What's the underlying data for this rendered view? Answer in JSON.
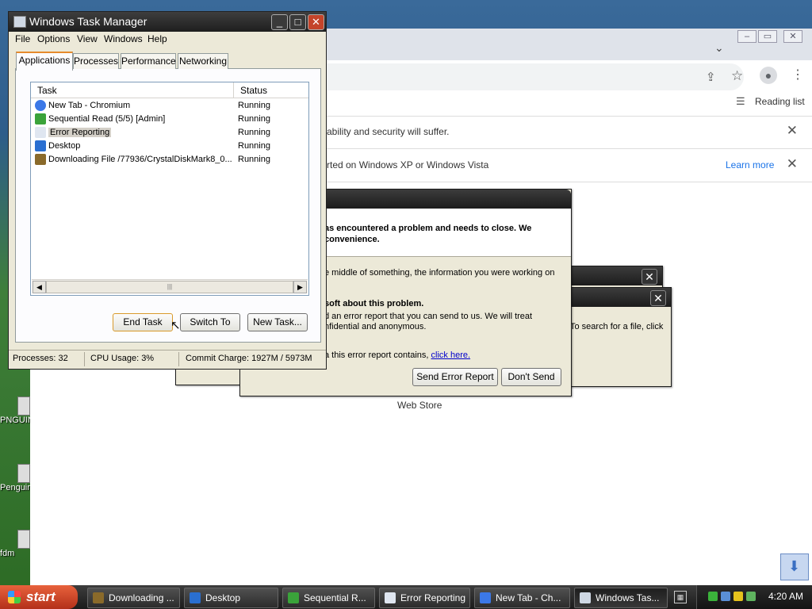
{
  "desktop": {
    "icons": [
      {
        "label": "PNGUIN"
      },
      {
        "label": "Penguin"
      },
      {
        "label": "fdm"
      }
    ]
  },
  "chrome": {
    "reading_list_label": "Reading list",
    "infobar1_text": "ability and security will suffer.",
    "infobar2_text": "rted on Windows XP or Windows Vista",
    "learn_more": "Learn more",
    "web_store_label": "Web Store"
  },
  "error_dialog": {
    "heading": "as encountered a problem and needs to close.  We",
    "heading2": "convenience.",
    "para1": "e middle of something, the information you were working on",
    "para2_title": "soft about this problem.",
    "para2_l1": "d an error report that you can send to us.  We will treat",
    "para2_l2": "nfidential and anonymous.",
    "para3": "a this error report contains,",
    "link": "click here.",
    "send_label": "Send Error Report",
    "dont_send_label": "Don't Send"
  },
  "search_dialog": {
    "text": "To search for a file, click"
  },
  "task_manager": {
    "title": "Windows Task Manager",
    "menu": [
      "File",
      "Options",
      "View",
      "Windows",
      "Help"
    ],
    "tabs": [
      "Applications",
      "Processes",
      "Performance",
      "Networking"
    ],
    "columns": {
      "task": "Task",
      "status": "Status"
    },
    "rows": [
      {
        "name": "New Tab - Chromium",
        "status": "Running",
        "icon": "chromium-icon",
        "color": "#3b78e7"
      },
      {
        "name": "Sequential Read (5/5) [Admin]",
        "status": "Running",
        "icon": "crystaldiskmark-icon",
        "color": "#3aa33a"
      },
      {
        "name": "Error Reporting",
        "status": "Running",
        "icon": "window-icon",
        "color": "#dfe6f0"
      },
      {
        "name": "Desktop",
        "status": "Running",
        "icon": "ie-icon",
        "color": "#2a6fd1"
      },
      {
        "name": "Downloading File /77936/CrystalDiskMark8_0...",
        "status": "Running",
        "icon": "fdm-icon",
        "color": "#8a6a2a"
      }
    ],
    "buttons": {
      "end_task": "End Task",
      "switch_to": "Switch To",
      "new_task": "New Task..."
    },
    "status": {
      "processes": "Processes: 32",
      "cpu": "CPU Usage: 3%",
      "commit": "Commit Charge: 1927M / 5973M"
    }
  },
  "taskbar": {
    "start_label": "start",
    "buttons": [
      {
        "label": "Downloading ...",
        "icon": "fdm-icon",
        "color": "#8a6a2a"
      },
      {
        "label": "Desktop",
        "icon": "ie-icon",
        "color": "#2a6fd1"
      },
      {
        "label": "Sequential R...",
        "icon": "crystaldiskmark-icon",
        "color": "#3aa33a"
      },
      {
        "label": "Error Reporting",
        "icon": "window-icon",
        "color": "#dfe6f0"
      },
      {
        "label": "New Tab - Ch...",
        "icon": "chromium-icon",
        "color": "#3b78e7"
      },
      {
        "label": "Windows Tas...",
        "icon": "taskmgr-icon",
        "color": "#cfd8e4"
      }
    ],
    "clock": "4:20 AM"
  }
}
